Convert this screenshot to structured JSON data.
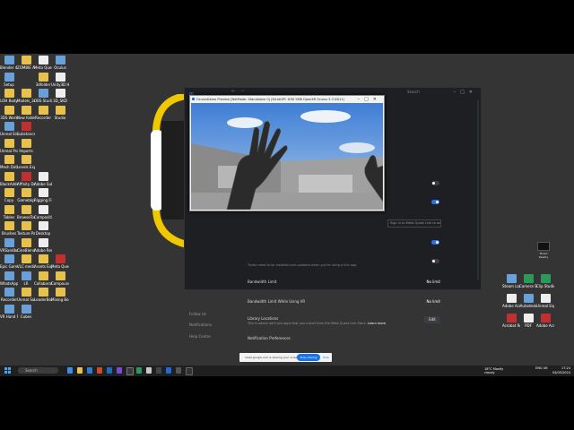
{
  "desktop_icons_left": [
    {
      "label": "Blender 4.1",
      "kind": "app"
    },
    {
      "label": "ZOMBIE ANIM...",
      "kind": "folder"
    },
    {
      "label": "Meta Quest Link",
      "kind": "doc"
    },
    {
      "label": "Oculus",
      "kind": "app"
    },
    {
      "label": "Setup",
      "kind": "app"
    },
    {
      "label": "",
      "kind": "none"
    },
    {
      "label": "3dfolder",
      "kind": "folder"
    },
    {
      "label": "Unity3D Hub",
      "kind": "doc"
    },
    {
      "label": "LOH Body",
      "kind": "folder"
    },
    {
      "label": "Models_3d",
      "kind": "folder"
    },
    {
      "label": "OBS Studio",
      "kind": "app"
    },
    {
      "label": "3D_SKD",
      "kind": "doc"
    },
    {
      "label": "3DS Work",
      "kind": "folder"
    },
    {
      "label": "New folder",
      "kind": "folder"
    },
    {
      "label": "Recorder",
      "kind": "folder"
    },
    {
      "label": "Studio",
      "kind": "folder"
    },
    {
      "label": "Unreal Engine",
      "kind": "app"
    },
    {
      "label": "Substance Painter",
      "kind": "red"
    },
    {
      "label": "",
      "kind": "none"
    },
    {
      "label": "",
      "kind": "none"
    },
    {
      "label": "Unreal Proj",
      "kind": "folder"
    },
    {
      "label": "Imports",
      "kind": "folder"
    },
    {
      "label": "",
      "kind": "none"
    },
    {
      "label": "",
      "kind": "none"
    },
    {
      "label": "Mesh Data",
      "kind": "folder"
    },
    {
      "label": "Levels Export",
      "kind": "folder"
    },
    {
      "label": "",
      "kind": "none"
    },
    {
      "label": "",
      "kind": "none"
    },
    {
      "label": "BlackAdder",
      "kind": "folder"
    },
    {
      "label": "Affinity Designer",
      "kind": "red"
    },
    {
      "label": "Adobe Substance",
      "kind": "doc"
    },
    {
      "label": "",
      "kind": "none"
    },
    {
      "label": "Copy",
      "kind": "folder"
    },
    {
      "label": "Gamebkp",
      "kind": "folder"
    },
    {
      "label": "Rigging Fix",
      "kind": "doc"
    },
    {
      "label": "",
      "kind": "none"
    },
    {
      "label": "Tables",
      "kind": "folder"
    },
    {
      "label": "BrowseTool",
      "kind": "folder"
    },
    {
      "label": "Compositions",
      "kind": "doc"
    },
    {
      "label": "",
      "kind": "none"
    },
    {
      "label": "Brushes",
      "kind": "folder"
    },
    {
      "label": "Texture Packs",
      "kind": "folder"
    },
    {
      "label": "Desktop",
      "kind": "doc"
    },
    {
      "label": "",
      "kind": "none"
    },
    {
      "label": "VRSandbox Meta 3.1",
      "kind": "app"
    },
    {
      "label": "CineBlender Meta 3.1",
      "kind": "folder"
    },
    {
      "label": "Adobe Rendering 3.1",
      "kind": "doc"
    },
    {
      "label": "",
      "kind": "none"
    },
    {
      "label": "Epic Games Launcher",
      "kind": "app"
    },
    {
      "label": "VLC media player",
      "kind": "folder"
    },
    {
      "label": "Assets Export",
      "kind": "folder"
    },
    {
      "label": "Meta Quest Studio",
      "kind": "red"
    },
    {
      "label": "WhatsApp Desktop",
      "kind": "app"
    },
    {
      "label": "LR",
      "kind": "app"
    },
    {
      "label": "Collaborator",
      "kind": "folder"
    },
    {
      "label": "Compound",
      "kind": "folder"
    },
    {
      "label": "Recorder",
      "kind": "app"
    },
    {
      "label": "Unreal Source",
      "kind": "folder"
    },
    {
      "label": "LeaderBoard",
      "kind": "folder"
    },
    {
      "label": "Mixing Bodies",
      "kind": "folder"
    },
    {
      "label": "VR Hand Pack",
      "kind": "app"
    },
    {
      "label": "Cubes",
      "kind": "app"
    },
    {
      "label": "",
      "kind": "none"
    },
    {
      "label": "",
      "kind": "none"
    }
  ],
  "desktop_icons_right": [
    {
      "label": "Steam Launcher",
      "kind": "app"
    },
    {
      "label": "Camera Studio",
      "kind": "green"
    },
    {
      "label": "Clip Studio",
      "kind": "green"
    },
    {
      "label": "Adobe Acrobat",
      "kind": "doc"
    },
    {
      "label": "Autodesk",
      "kind": "app"
    },
    {
      "label": "Unreal Export",
      "kind": "doc"
    },
    {
      "label": "Acrobat Reader",
      "kind": "red"
    },
    {
      "label": "PDF",
      "kind": "doc"
    },
    {
      "label": "Adobe Acrobat",
      "kind": "red"
    }
  ],
  "meta_window": {
    "logo": "∞",
    "search_placeholder": "Search",
    "sidebar": [
      "Follow Us",
      "Notifications",
      "Help Centre"
    ],
    "hint_text": "Sign in to Meta Quest Link to sel...",
    "update_text": "These need to be installed and updated when you're using a link app.",
    "bandwidth_label": "Bandwidth Limit",
    "bandwidth_value": "No limit",
    "bandwidth_vr_label": "Bandwidth Limit While Using VR",
    "bandwidth_vr_value": "No limit",
    "library_label": "Library Locations",
    "library_desc": "This is where we'll put apps that you install from the Meta Quest Link Store.",
    "library_link": "Learn more",
    "edit_label": "Edit",
    "notif_label": "Notification Preferences"
  },
  "oculus_window": {
    "title": "OculusDemo Preview [NetMode: Standalone 0] (64-bit/PC D3D SM6 OpenXR Oculus 5.3 DX11)"
  },
  "sharebar": {
    "message": "meet.google.com is sharing your screen.",
    "stop_label": "Stop sharing",
    "hide_label": "Hide"
  },
  "taskbar": {
    "search_placeholder": "Search",
    "weather": "18°C Mostly cloudy",
    "lang": "ENG UK",
    "time": "17:24",
    "date": "04/05/2024"
  },
  "desktop_unlabeled_icon": "Mixed Reality",
  "colors": {
    "accent": "#2a6ff0",
    "desktop": "#343434",
    "taskbar": "#202020",
    "headset_yellow": "#f0c800"
  }
}
